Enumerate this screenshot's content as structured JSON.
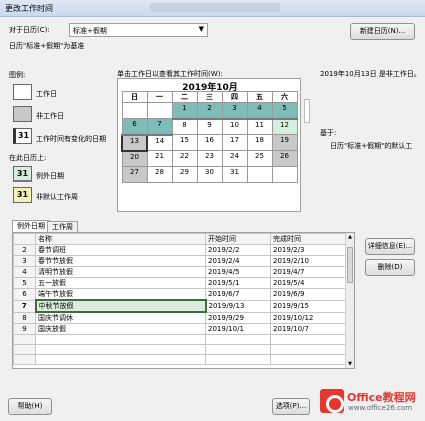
{
  "window": {
    "title": "更改工作时间"
  },
  "calendar_selector": {
    "label": "对于日历(C):",
    "value": "标准+假期",
    "base_note": "日历\"标准+假期\"为基准",
    "new_button": "新建日历(N)..."
  },
  "legend": {
    "title": "图例:",
    "items": [
      {
        "label": "工作日",
        "box": ""
      },
      {
        "label": "非工作日",
        "box": ""
      },
      {
        "label": "工作时间有变化的日期",
        "box": "31"
      }
    ],
    "on_this_calendar": "在此日历上:",
    "items2": [
      {
        "label": "例外日期",
        "box": "31"
      },
      {
        "label": "非默认工作周",
        "box": "31"
      }
    ]
  },
  "calendar_view": {
    "instruction": "单击工作日以查看其工作时间(W):",
    "month_title": "2019年10月",
    "weekdays": [
      "日",
      "一",
      "二",
      "三",
      "四",
      "五",
      "六"
    ],
    "weeks": [
      [
        "",
        "",
        "1",
        "2",
        "3",
        "4",
        "5"
      ],
      [
        "6",
        "7",
        "8",
        "9",
        "10",
        "11",
        "12"
      ],
      [
        "13",
        "14",
        "15",
        "16",
        "17",
        "18",
        "19"
      ],
      [
        "20",
        "21",
        "22",
        "23",
        "24",
        "25",
        "26"
      ],
      [
        "27",
        "28",
        "29",
        "30",
        "31",
        "",
        ""
      ]
    ]
  },
  "info": {
    "date_note": "2019年10月13日 是非工作日。",
    "based_on_label": "基于:",
    "based_on_value": "日历\"标准+假期\"的默认工"
  },
  "tabs": [
    {
      "label": "例外日期"
    },
    {
      "label": "工作周"
    }
  ],
  "table": {
    "columns": [
      "名称",
      "开始时间",
      "完成时间"
    ],
    "rows": [
      {
        "n": "2",
        "name": "春节调班",
        "start": "2019/2/2",
        "end": "2019/2/3"
      },
      {
        "n": "3",
        "name": "春节节放假",
        "start": "2019/2/4",
        "end": "2019/2/10"
      },
      {
        "n": "4",
        "name": "清明节放假",
        "start": "2019/4/5",
        "end": "2019/4/7"
      },
      {
        "n": "5",
        "name": "五一放假",
        "start": "2019/5/1",
        "end": "2019/5/4"
      },
      {
        "n": "6",
        "name": "端午节放假",
        "start": "2019/6/7",
        "end": "2019/6/9"
      },
      {
        "n": "7",
        "name": "中秋节放假",
        "start": "2019/9/13",
        "end": "2019/9/15"
      },
      {
        "n": "8",
        "name": "国庆节调休",
        "start": "2019/9/29",
        "end": "2019/10/12"
      },
      {
        "n": "9",
        "name": "国庆放假",
        "start": "2019/10/1",
        "end": "2019/10/7"
      }
    ]
  },
  "side_buttons": {
    "details": "详细信息(E)...",
    "delete": "删除(D)"
  },
  "footer": {
    "help": "帮助(H)",
    "options": "选项(P)...",
    "ok": "确定"
  },
  "watermark": {
    "brand": "Office教程网",
    "url": "www.office26.com"
  },
  "colors": {
    "exception_day": "#7dbcb7",
    "nonworking_day": "#c8c8c8",
    "changed_day": "#d4efe0"
  }
}
